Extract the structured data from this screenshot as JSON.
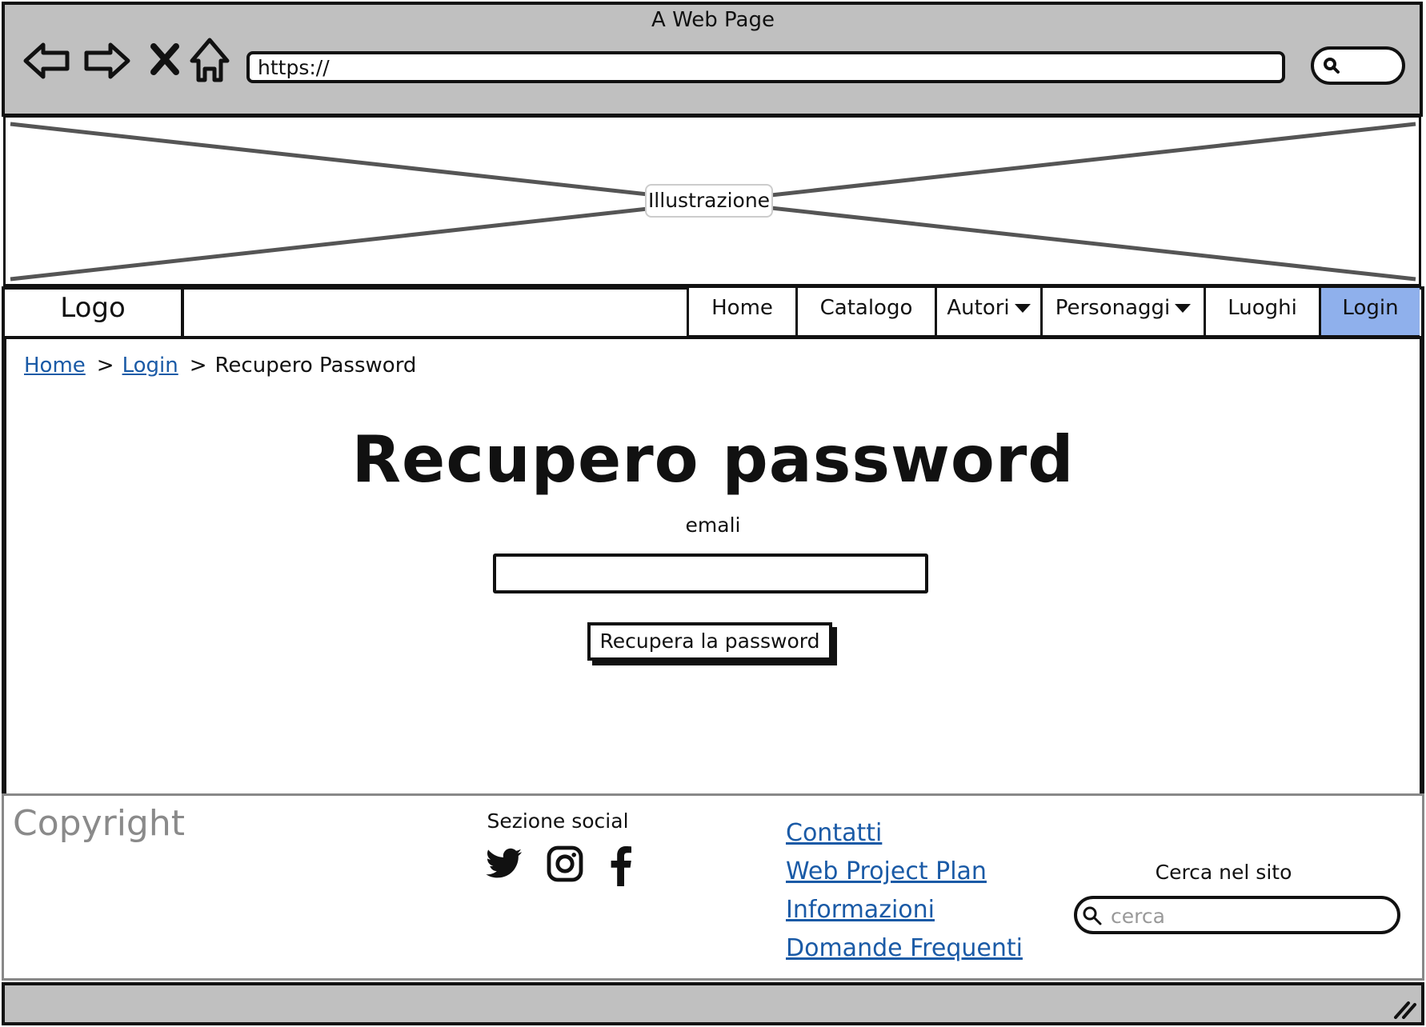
{
  "window": {
    "title": "A Web Page"
  },
  "browser": {
    "url": "https://",
    "icons": [
      "back-arrow-icon",
      "forward-arrow-icon",
      "close-x-icon",
      "home-icon",
      "search-icon"
    ]
  },
  "banner": {
    "label": "Illustrazione"
  },
  "navbar": {
    "logo": "Logo",
    "items": [
      {
        "label": "Home",
        "dropdown": false
      },
      {
        "label": "Catalogo",
        "dropdown": false
      },
      {
        "label": "Autori",
        "dropdown": true
      },
      {
        "label": "Personaggi",
        "dropdown": true
      },
      {
        "label": "Luoghi",
        "dropdown": false
      },
      {
        "label": "Login",
        "dropdown": false,
        "active": true
      }
    ],
    "active_color": "#8fb0ec"
  },
  "breadcrumb": {
    "items": [
      "Home",
      "Login",
      "Recupero Password"
    ],
    "separator": ">"
  },
  "main": {
    "title": "Recupero password",
    "email_label": "emali",
    "email_value": "",
    "submit_label": "Recupera la password"
  },
  "footer": {
    "copyright": "Copyright",
    "social_title": "Sezione social",
    "social_icons": [
      "twitter-icon",
      "instagram-icon",
      "facebook-icon"
    ],
    "links": [
      "Contatti",
      "Web Project Plan",
      "Informazioni",
      "Domande Frequenti"
    ],
    "search_title": "Cerca nel sito",
    "search_placeholder": "cerca",
    "link_color": "#1a5aa6"
  }
}
